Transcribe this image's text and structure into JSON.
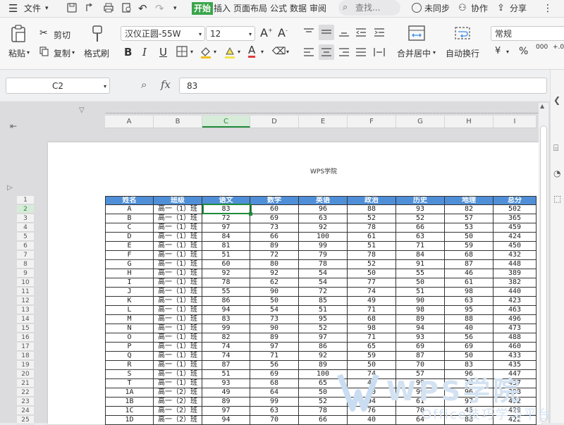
{
  "menubar": {
    "file_label": "文件",
    "tabs": [
      "开始",
      "插入",
      "页面布局",
      "公式",
      "数据",
      "审阅"
    ],
    "search_placeholder": "查找...",
    "sync_label": "未同步",
    "collab_label": "协作",
    "share_label": "分享"
  },
  "ribbon": {
    "paste": "粘贴",
    "cut": "剪切",
    "copy": "复制",
    "format_painter": "格式刷",
    "font_name": "汉仪正圆-55W",
    "font_size": "12",
    "merge_center": "合并居中",
    "wrap_text": "自动换行",
    "number_format": "常规",
    "currency": "¥",
    "percent": "%",
    "thousands": "000"
  },
  "formula_bar": {
    "name_box": "C2",
    "fx": "fx",
    "value": "83"
  },
  "sheet": {
    "print_title": "WPS学院",
    "columns": [
      "A",
      "B",
      "C",
      "D",
      "E",
      "F",
      "G",
      "H",
      "I"
    ],
    "rows": [
      "1",
      "2",
      "3",
      "4",
      "5",
      "6",
      "7",
      "8",
      "9",
      "10",
      "11",
      "12",
      "13",
      "14",
      "15",
      "16",
      "17",
      "18",
      "19",
      "20",
      "21",
      "22",
      "23",
      "24",
      "25"
    ],
    "header": [
      "姓名",
      "班级",
      "语文",
      "数学",
      "英语",
      "政治",
      "历史",
      "地理",
      "总分"
    ],
    "data": [
      [
        "A",
        "高一（1）班",
        "83",
        "60",
        "96",
        "88",
        "93",
        "82",
        "502"
      ],
      [
        "B",
        "高一（1）班",
        "72",
        "69",
        "63",
        "52",
        "52",
        "57",
        "365"
      ],
      [
        "C",
        "高一（1）班",
        "97",
        "73",
        "92",
        "78",
        "66",
        "53",
        "459"
      ],
      [
        "D",
        "高一（1）班",
        "84",
        "66",
        "100",
        "61",
        "63",
        "50",
        "424"
      ],
      [
        "E",
        "高一（1）班",
        "81",
        "89",
        "99",
        "51",
        "71",
        "59",
        "450"
      ],
      [
        "F",
        "高一（1）班",
        "51",
        "72",
        "79",
        "78",
        "84",
        "68",
        "432"
      ],
      [
        "G",
        "高一（1）班",
        "60",
        "80",
        "78",
        "52",
        "91",
        "87",
        "448"
      ],
      [
        "H",
        "高一（1）班",
        "92",
        "92",
        "54",
        "50",
        "55",
        "46",
        "389"
      ],
      [
        "I",
        "高一（1）班",
        "78",
        "62",
        "54",
        "77",
        "50",
        "61",
        "382"
      ],
      [
        "J",
        "高一（1）班",
        "55",
        "90",
        "72",
        "74",
        "51",
        "98",
        "440"
      ],
      [
        "K",
        "高一（1）班",
        "86",
        "50",
        "85",
        "49",
        "90",
        "63",
        "423"
      ],
      [
        "L",
        "高一（1）班",
        "94",
        "54",
        "51",
        "71",
        "98",
        "95",
        "463"
      ],
      [
        "M",
        "高一（1）班",
        "83",
        "73",
        "95",
        "68",
        "89",
        "88",
        "496"
      ],
      [
        "N",
        "高一（1）班",
        "99",
        "90",
        "52",
        "98",
        "94",
        "40",
        "473"
      ],
      [
        "O",
        "高一（1）班",
        "82",
        "89",
        "97",
        "71",
        "93",
        "56",
        "488"
      ],
      [
        "P",
        "高一（1）班",
        "74",
        "97",
        "86",
        "65",
        "69",
        "69",
        "460"
      ],
      [
        "Q",
        "高一（1）班",
        "74",
        "71",
        "92",
        "59",
        "87",
        "50",
        "433"
      ],
      [
        "R",
        "高一（1）班",
        "87",
        "56",
        "89",
        "50",
        "70",
        "83",
        "435"
      ],
      [
        "S",
        "高一（1）班",
        "51",
        "69",
        "100",
        "74",
        "57",
        "96",
        "447"
      ],
      [
        "T",
        "高一（1）班",
        "93",
        "68",
        "65",
        "40",
        "99",
        "72",
        "437"
      ],
      [
        "1A",
        "高一（2）班",
        "49",
        "64",
        "50",
        "40",
        "99",
        "96",
        "398"
      ],
      [
        "1B",
        "高一（2）班",
        "89",
        "99",
        "52",
        "94",
        "61",
        "97",
        "492"
      ],
      [
        "1C",
        "高一（2）班",
        "97",
        "63",
        "78",
        "76",
        "70",
        "45",
        "429"
      ],
      [
        "1D",
        "高一（2）班",
        "94",
        "70",
        "66",
        "40",
        "64",
        "88",
        "422"
      ]
    ]
  },
  "watermark": {
    "brand": "WPS学院",
    "tagline": "Office技巧学习平台"
  }
}
